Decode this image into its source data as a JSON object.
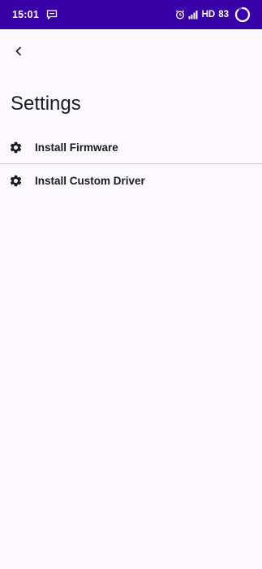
{
  "status_bar": {
    "time": "15:01",
    "network": "HD",
    "battery": "83",
    "icons": [
      "message-icon",
      "alarm-icon",
      "signal-icon",
      "battery-ring-icon"
    ]
  },
  "header": {
    "back_icon": "back-arrow-icon",
    "title": "Settings"
  },
  "settings": {
    "items": [
      {
        "label": "Install Firmware",
        "icon": "gear-icon"
      },
      {
        "label": "Install Custom Driver",
        "icon": "gear-icon"
      }
    ]
  },
  "colors": {
    "status_bar_bg": "#3a00a8",
    "page_bg": "#fbf8fe",
    "text": "#1c1b1f",
    "divider": "#c9c5cf"
  }
}
